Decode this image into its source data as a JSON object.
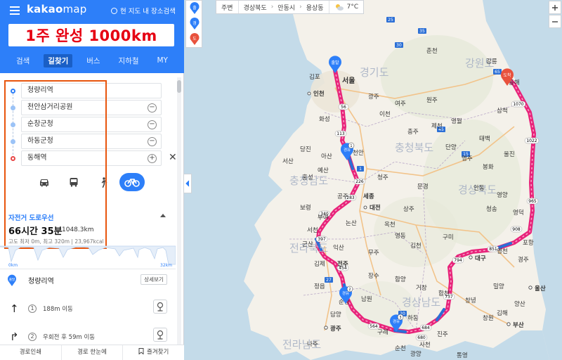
{
  "app": {
    "logo_brand": "kakao",
    "logo_product": "map",
    "here_search": "현 지도 내 장소검색"
  },
  "banner": {
    "text": "1주 완성 1000km"
  },
  "tabs": [
    {
      "label": "검색"
    },
    {
      "label": "길찾기",
      "active": true
    },
    {
      "label": "버스"
    },
    {
      "label": "지하철"
    },
    {
      "label": "MY"
    }
  ],
  "route": {
    "waypoints": [
      {
        "label": "청량리역",
        "type": "start"
      },
      {
        "label": "천안삼거리공원",
        "type": "via",
        "control": "−"
      },
      {
        "label": "순창군청",
        "type": "via",
        "control": "−"
      },
      {
        "label": "하동군청",
        "type": "via",
        "control": "−"
      },
      {
        "label": "동해역",
        "type": "end",
        "control": "+"
      }
    ],
    "close": "✕",
    "modes": [
      {
        "name": "car",
        "icon": "car-icon"
      },
      {
        "name": "bus",
        "icon": "bus-icon"
      },
      {
        "name": "walk",
        "icon": "walk-icon"
      },
      {
        "name": "bike",
        "icon": "bicycle-icon",
        "active": true
      }
    ],
    "option": "자전거 도로우선",
    "duration": "66시간 35분",
    "distance": "1048.3km",
    "elevation": "고도 최저 0m, 최고 320m  |  23,967kcal",
    "profile_start": "0km",
    "profile_end": "32km"
  },
  "steps": {
    "start_badge": "출발",
    "start_label": "청량리역",
    "detail_btn": "상세보기",
    "items": [
      {
        "num": "1",
        "arrow": "↑",
        "text": "188m 이동"
      },
      {
        "num": "2",
        "arrow": "↱",
        "text": "우회전 후 59m 이동"
      }
    ]
  },
  "bottom": {
    "items": [
      "경로인쇄",
      "경로 한눈에",
      "즐겨찾기"
    ]
  },
  "map": {
    "side_buttons": [
      "출",
      "경",
      "도"
    ],
    "bar": {
      "nearby": "주변",
      "region1": "경상북도",
      "region2": "안동시",
      "region3": "용상동",
      "weather": "7°C"
    },
    "badges": {
      "start": "출발",
      "end": "도착",
      "via": "경유"
    },
    "via_numbers": [
      "1",
      "2",
      "3"
    ],
    "provinces": {
      "gyeonggi": "경기도",
      "gangwon": "강원도",
      "chungbuk": "충청북도",
      "chungnam": "충청남도",
      "gyeongbuk": "경상북도",
      "jeonbuk": "전라북도",
      "jeonnam": "전라남도",
      "gyeongnam": "경상남도"
    },
    "cities": {
      "gimpo": "김포",
      "incheon": "인천",
      "seoul": "서울",
      "hwaseong": "화성",
      "gwangju_gg": "광주",
      "icheon": "이천",
      "yeoju": "여주",
      "wonju": "원주",
      "chuncheon": "춘천",
      "gangneung": "강릉",
      "donghae": "동해",
      "taebaek": "태백",
      "yeongwol": "영월",
      "jecheon": "제천",
      "chungju": "충주",
      "cheongju": "청주",
      "danyang": "단양",
      "yeongju": "영주",
      "bonghwa": "봉화",
      "andong": "안동",
      "seosan": "서산",
      "dangjin": "당진",
      "asan": "아산",
      "cheonan": "천안",
      "hongseong": "홍성",
      "yesan": "예산",
      "sejong": "세종",
      "daejeon": "대전",
      "gongju": "공주",
      "boryeong": "보령",
      "nonsan": "논산",
      "buyeo": "부여",
      "seocheon": "서천",
      "gunsan": "군산",
      "iksan": "익산",
      "jeonju": "전주",
      "gimje": "김제",
      "jeongeup": "정읍",
      "namwon": "남원",
      "sunchang": "순창",
      "damyang": "담양",
      "gwangju": "광주",
      "naju": "나주",
      "suncheon": "순천",
      "gwangyang": "광양",
      "hadong": "하동",
      "jinju": "진주",
      "sacheon": "사천",
      "tongyeong": "통영",
      "changwon": "창원",
      "busan": "부산",
      "gimhae": "김해",
      "miryang": "밀양",
      "ulsan": "울산",
      "gyeongju": "경주",
      "pohang": "포항",
      "yeongcheon": "영천",
      "daegu": "대구",
      "gumi": "구미",
      "gimcheon": "김천",
      "sangju": "상주",
      "mungyeong": "문경",
      "yeongdeok": "영덕",
      "uljin": "울진",
      "samcheok": "삼척",
      "muju": "무주",
      "geochang": "거창",
      "hamyang": "함양",
      "hapcheon": "합천",
      "changnyeong": "창녕",
      "cheongsong": "청송",
      "yeongyang": "영양",
      "gurye": "구례",
      "jangsu": "장수",
      "okcheon": "옥천",
      "yeongdong": "영동",
      "gimhae2": "양산"
    },
    "shields": [
      "56",
      "113",
      "1",
      "226",
      "283",
      "340",
      "397",
      "454",
      "27",
      "684",
      "680",
      "564",
      "20",
      "737",
      "794",
      "851",
      "908",
      "965",
      "1022",
      "1070",
      "65",
      "35",
      "30",
      "25",
      "15",
      "45"
    ]
  },
  "colors": {
    "brand": "#2d7ff9",
    "route": "#e8237a",
    "highlight": "#e8550d",
    "banner_text": "#e60012"
  }
}
